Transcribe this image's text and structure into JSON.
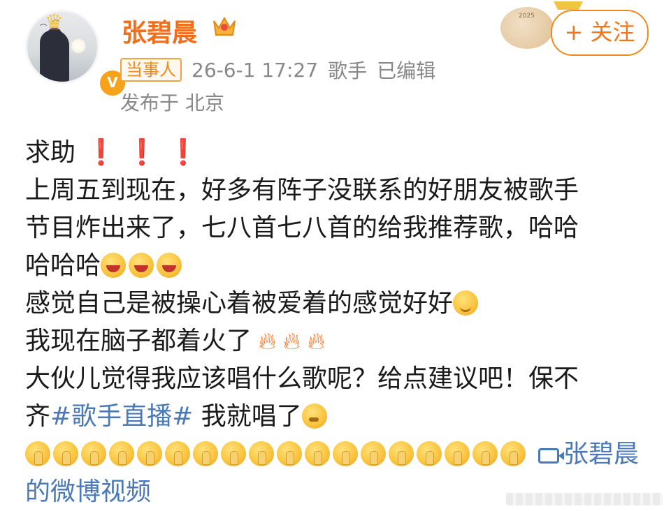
{
  "header": {
    "username": "张碧晨",
    "tag": "当事人",
    "timestamp": "26-6-1 17:27",
    "category": "歌手",
    "edited": "已编辑",
    "location": "发布于 北京",
    "follow_label": "+ 关注",
    "verified_icon": "verified-v-icon",
    "member_icon": "vip-crown-icon"
  },
  "post": {
    "line1": "求助",
    "line1_marks": [
      "❗",
      "❗",
      "❗"
    ],
    "line2": "上周五到现在，好多有阵子没联系的好朋友被歌手",
    "line3": "节目炸出来了，七八首七八首的给我推荐歌，哈哈",
    "line4": "哈哈哈",
    "line5": "感觉自己是被操心着被爱着的感觉好好",
    "line6": "我现在脑子都着火了",
    "line7": "大伙儿觉得我应该唱什么歌呢？给点建议吧！保不",
    "line8_prefix": "齐",
    "hashtag": "#歌手直播#",
    "line8_suffix": " 我就唱了",
    "video_link_part1": "张碧晨",
    "video_link_part2": "的微博视频"
  },
  "colors": {
    "accent": "#f06f1f",
    "link": "#4b78b6",
    "meta": "#888888",
    "exclaim": "#e1251b"
  }
}
